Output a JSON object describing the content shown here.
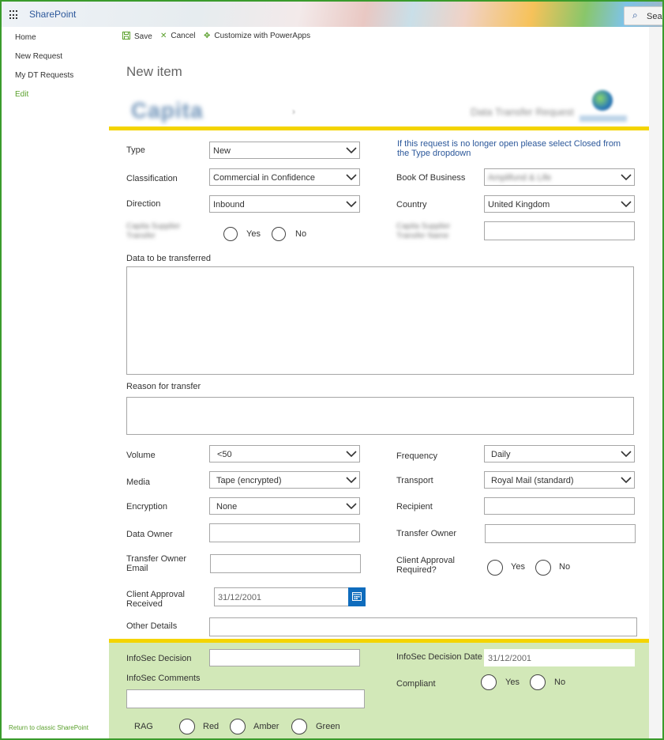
{
  "suitebar": {
    "brand": "SharePoint",
    "search_label": "Search"
  },
  "nav": {
    "items": [
      "Home",
      "New Request",
      "My DT Requests"
    ],
    "edit": "Edit",
    "return_link": "Return to classic SharePoint"
  },
  "commands": {
    "save": "Save",
    "cancel": "Cancel",
    "customize": "Customize with PowerApps"
  },
  "page": {
    "title": "New item"
  },
  "banner": {
    "logo": "Capita",
    "title": "Data Transfer Request"
  },
  "form": {
    "type": {
      "label": "Type",
      "value": "New"
    },
    "info_text": "If this request is no longer open please select Closed from the Type dropdown",
    "classification": {
      "label": "Classification",
      "value": "Commercial in Confidence"
    },
    "book_of_business": {
      "label": "Book Of Business",
      "value": "Amplifund & Life"
    },
    "direction": {
      "label": "Direction",
      "value": "Inbound"
    },
    "country": {
      "label": "Country",
      "value": "United Kingdom"
    },
    "supplier_transfer": {
      "label": "Capita Supplier Transfer",
      "yes": "Yes",
      "no": "No"
    },
    "supplier_name": {
      "label": "Capita Supplier Transfer Name"
    },
    "data_to_transfer": {
      "label": "Data to be transferred"
    },
    "reason": {
      "label": "Reason for transfer"
    },
    "volume": {
      "label": "Volume",
      "value": "<50"
    },
    "frequency": {
      "label": "Frequency",
      "value": "Daily"
    },
    "media": {
      "label": "Media",
      "value": "Tape (encrypted)"
    },
    "transport": {
      "label": "Transport",
      "value": "Royal Mail (standard)"
    },
    "encryption": {
      "label": "Encryption",
      "value": "None"
    },
    "recipient": {
      "label": "Recipient"
    },
    "data_owner": {
      "label": "Data Owner"
    },
    "transfer_owner": {
      "label": "Transfer Owner"
    },
    "transfer_owner_email": {
      "label": "Transfer Owner Email"
    },
    "client_approval_required": {
      "label": "Client Approval Required?",
      "yes": "Yes",
      "no": "No"
    },
    "client_approval_received": {
      "label": "Client Approval Received",
      "value": "31/12/2001"
    },
    "other_details": {
      "label": "Other Details"
    }
  },
  "infosec": {
    "decision": {
      "label": "InfoSec Decision"
    },
    "decision_date": {
      "label": "InfoSec Decision Date",
      "value": "31/12/2001"
    },
    "comments": {
      "label": "InfoSec Comments"
    },
    "compliant": {
      "label": "Compliant",
      "yes": "Yes",
      "no": "No"
    },
    "rag": {
      "label": "RAG",
      "red": "Red",
      "amber": "Amber",
      "green": "Green"
    }
  },
  "colors": {
    "accent_green": "#5aa02c",
    "link_blue": "#2b579a",
    "banner_yellow": "#f4d400",
    "infosec_bg": "#d2e8b8",
    "calendar_blue": "#0f6cbd"
  }
}
